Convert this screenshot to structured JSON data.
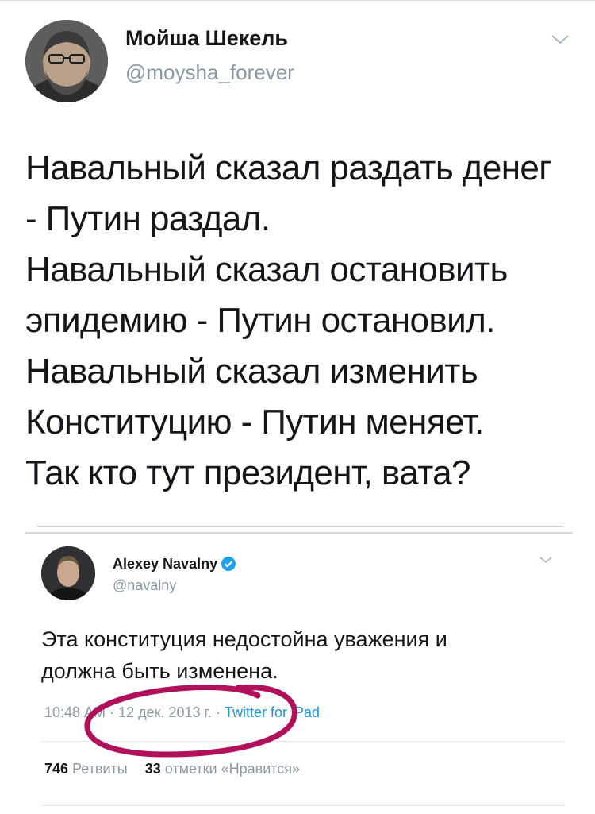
{
  "tweet": {
    "author_name": "Мойша Шекель",
    "author_handle": "@moysha_forever",
    "lines": [
      "Навальный сказал раздать денег",
      "- Путин раздал.",
      "Навальный сказал остановить",
      "эпидемию - Путин остановил.",
      "Навальный сказал изменить",
      "Конституцию - Путин меняет.",
      "Так кто тут президент, вата?"
    ]
  },
  "quoted": {
    "author_name": "Alexey Navalny",
    "author_handle": "@navalny",
    "lines": [
      "Эта конституция недостойна уважения и",
      "должна быть изменена."
    ],
    "time": "10:48 АМ",
    "date": "12 дек. 2013 г.",
    "source": "Twitter for iPad",
    "separator": "·",
    "retweets_count": "746",
    "retweets_label": "Ретвиты",
    "likes_count": "33",
    "likes_label": "отметки «Нравится»"
  },
  "colors": {
    "text": "#14171a",
    "secondary": "#8899a6",
    "link": "#1b95e0",
    "verified": "#1da1f2",
    "annotation": "#b0115a"
  },
  "icons": {
    "chevron": "chevron-down-icon",
    "verified": "verified-badge-icon"
  }
}
